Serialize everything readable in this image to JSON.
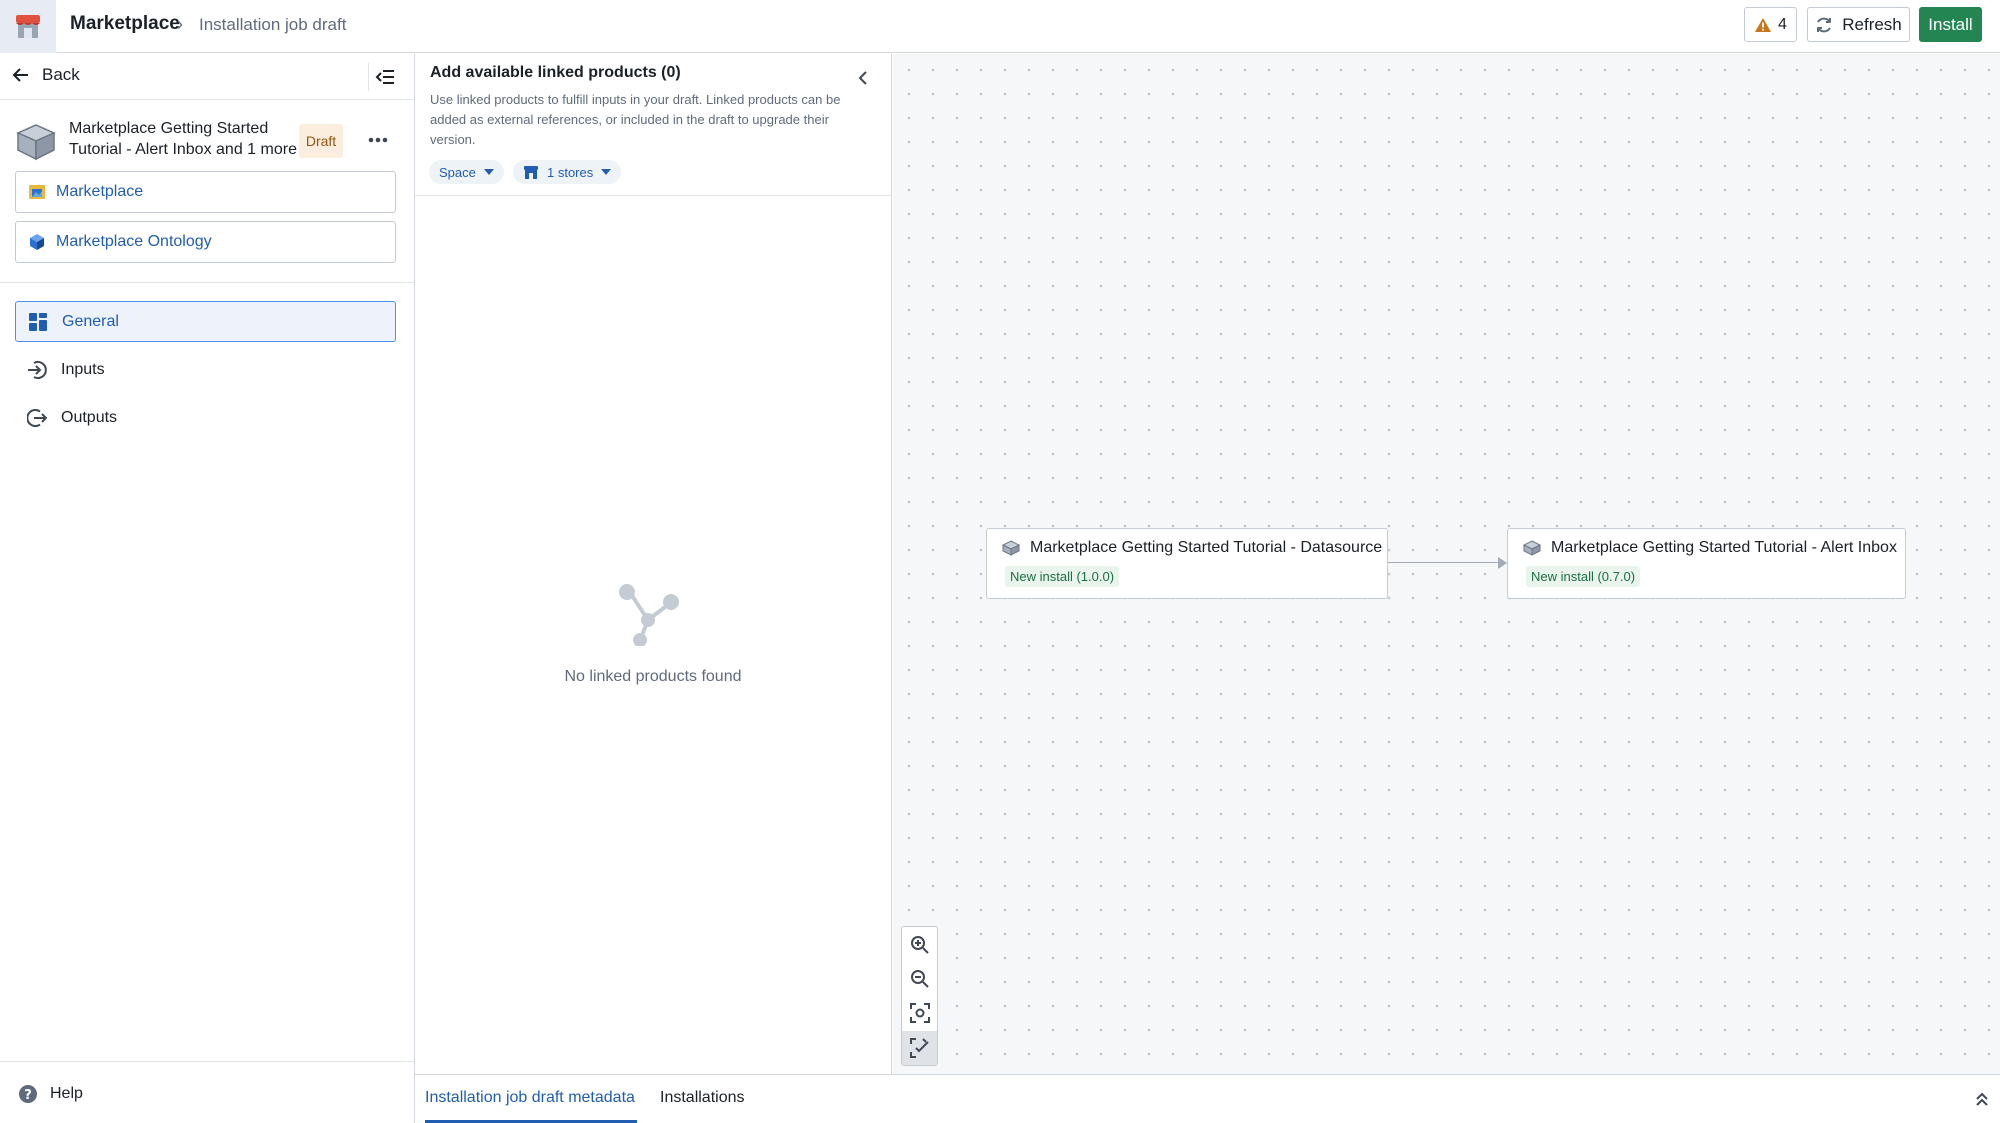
{
  "header": {
    "app_title": "Marketplace",
    "breadcrumb_separator": "›",
    "breadcrumb_current": "Installation job draft",
    "warnings_count": "4",
    "refresh_label": "Refresh",
    "install_label": "Install"
  },
  "sidebar": {
    "back_label": "Back",
    "product_title": "Marketplace Getting Started Tutorial - Alert Inbox and 1 more",
    "draft_badge": "Draft",
    "links": [
      {
        "label": "Marketplace",
        "icon": "marketplace-store-icon"
      },
      {
        "label": "Marketplace Ontology",
        "icon": "ontology-cube-icon"
      }
    ],
    "nav": [
      {
        "label": "General",
        "icon": "dashboard-grid-icon",
        "active": true
      },
      {
        "label": "Inputs",
        "icon": "log-in-arrow-icon",
        "active": false
      },
      {
        "label": "Outputs",
        "icon": "log-out-arrow-icon",
        "active": false
      }
    ],
    "help_label": "Help"
  },
  "linked_products": {
    "title": "Add available linked products (0)",
    "description": "Use linked products to fulfill inputs in your draft. Linked products can be added as external references, or included in the draft to upgrade their version.",
    "filters": {
      "space_label": "Space",
      "stores_label": "1 stores"
    },
    "empty_text": "No linked products found"
  },
  "graph": {
    "nodes": [
      {
        "title": "Marketplace Getting Started Tutorial - Datasource",
        "badge": "New install (1.0.0)"
      },
      {
        "title": "Marketplace Getting Started Tutorial - Alert Inbox",
        "badge": "New install (0.7.0)"
      }
    ],
    "zoom_controls": [
      "zoom-in-icon",
      "zoom-out-icon",
      "fit-to-screen-icon",
      "auto-layout-icon"
    ]
  },
  "bottom_tabs": [
    {
      "label": "Installation job draft metadata",
      "active": true
    },
    {
      "label": "Installations",
      "active": false
    }
  ],
  "colors": {
    "accent": "#215db0",
    "install_green": "#238551",
    "warning": "#c87619",
    "draft_badge_bg": "#fbeede",
    "new_install_badge_bg": "#e8f4ec"
  }
}
